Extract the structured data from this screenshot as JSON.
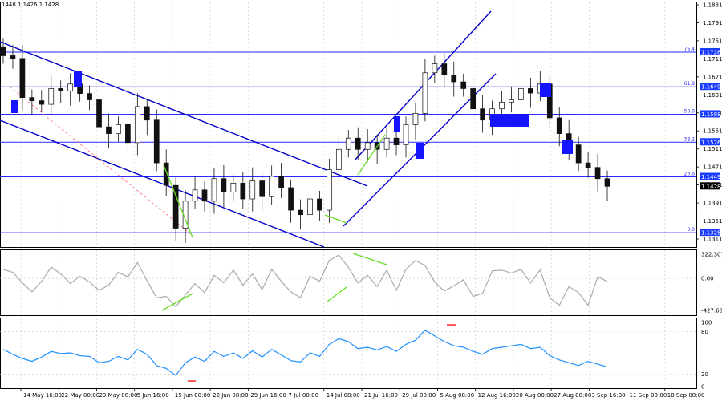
{
  "header": {
    "symbol": "1448",
    "ohlc": "1.1426 1.1428"
  },
  "colors": {
    "candles": "#111111",
    "channel": "#0000c8",
    "fib": "#2a2aff",
    "diverg": "#66dd22",
    "cci": "#aaaaaa",
    "rsi": "#1e90ff",
    "marker": "#1414ff",
    "redline": "#ff3030",
    "price_tag_bg": "#000000",
    "fib_tag_bg": "#1a3cff"
  },
  "price_axis": {
    "ticks": [
      "1.1831",
      "1.1791",
      "1.1751",
      "1.1711",
      "1.1671",
      "1.1631",
      "1.1591",
      "1.1551",
      "1.1511",
      "1.1471",
      "1.1431",
      "1.1391",
      "1.1351",
      "1.1311"
    ],
    "current_price": "1.1428"
  },
  "fib_levels": [
    {
      "ratio": "76.4",
      "price": "1.1726"
    },
    {
      "ratio": "61.8",
      "price": "1.1649"
    },
    {
      "ratio": "50.0",
      "price": "1.1588"
    },
    {
      "ratio": "38.2",
      "price": "1.1526"
    },
    {
      "ratio": "23.6",
      "price": "1.1449"
    },
    {
      "ratio": "0.0",
      "price": "1.1325"
    }
  ],
  "cci_axis": {
    "ticks": [
      "322.3074",
      "0.00",
      "-427.686"
    ]
  },
  "rsi_axis": {
    "ticks": [
      "100",
      "80",
      "20",
      "0"
    ]
  },
  "time_axis": {
    "labels": [
      "14 May 16:00",
      "22 May 00:00",
      "29 May 08:00",
      "5 Jun 16:00",
      "15 Jun 00:00",
      "22 Jun 08:00",
      "29 Jun 16:00",
      "7 Jul 00:00",
      "14 Jul 08:00",
      "21 Jul 16:00",
      "29 Jul 00:00",
      "5 Aug 08:00",
      "12 Aug 16:00",
      "20 Aug 00:00",
      "27 Aug 08:00",
      "3 Sep 16:00",
      "11 Sep 00:00",
      "18 Sep 08:00"
    ]
  },
  "chart_data": [
    {
      "type": "candlestick",
      "series": [
        {
          "name": "price",
          "close": [
            1.1718,
            1.1712,
            1.1625,
            1.1618,
            1.161,
            1.1645,
            1.164,
            1.1655,
            1.1634,
            1.162,
            1.156,
            1.1545,
            1.1565,
            1.1525,
            1.1605,
            1.1575,
            1.148,
            1.143,
            1.1335,
            1.1395,
            1.142,
            1.1395,
            1.1445,
            1.1415,
            1.1435,
            1.14,
            1.144,
            1.1405,
            1.145,
            1.1425,
            1.1375,
            1.1365,
            1.14,
            1.1375,
            1.1465,
            1.151,
            1.1535,
            1.151,
            1.1525,
            1.151,
            1.1535,
            1.152,
            1.1565,
            1.159,
            1.168,
            1.17,
            1.1675,
            1.166,
            1.1645,
            1.16,
            1.1575,
            1.16,
            1.1615,
            1.162,
            1.1645,
            1.1635,
            1.1655,
            1.158,
            1.1545,
            1.152,
            1.148,
            1.147,
            1.1445,
            1.1428
          ]
        }
      ],
      "ylim": [
        1.1311,
        1.1831
      ]
    },
    {
      "type": "line",
      "series": [
        {
          "name": "cci",
          "values": [
            120,
            80,
            -60,
            -180,
            -40,
            150,
            60,
            -70,
            30,
            -50,
            -160,
            -90,
            80,
            20,
            210,
            -30,
            -260,
            -240,
            -380,
            -220,
            -70,
            -190,
            40,
            -60,
            110,
            -90,
            60,
            -150,
            120,
            -40,
            -180,
            -260,
            30,
            -40,
            240,
            310,
            150,
            -60,
            40,
            -110,
            110,
            -160,
            120,
            240,
            170,
            -50,
            -170,
            -100,
            -20,
            -240,
            -200,
            100,
            110,
            70,
            120,
            -60,
            110,
            -260,
            -360,
            -110,
            -190,
            -360,
            20,
            -40
          ]
        }
      ],
      "ylim": [
        -427.686,
        322.3074
      ]
    },
    {
      "type": "line",
      "series": [
        {
          "name": "rsi",
          "values": [
            55,
            48,
            42,
            38,
            44,
            52,
            49,
            50,
            46,
            45,
            36,
            38,
            45,
            40,
            55,
            48,
            32,
            28,
            18,
            36,
            44,
            38,
            52,
            45,
            50,
            42,
            53,
            44,
            55,
            47,
            39,
            37,
            50,
            45,
            62,
            70,
            66,
            56,
            58,
            54,
            59,
            52,
            62,
            68,
            82,
            74,
            66,
            60,
            58,
            52,
            48,
            56,
            58,
            60,
            62,
            56,
            58,
            46,
            40,
            36,
            32,
            38,
            34,
            30
          ]
        }
      ],
      "ylim": [
        0,
        100
      ]
    }
  ]
}
